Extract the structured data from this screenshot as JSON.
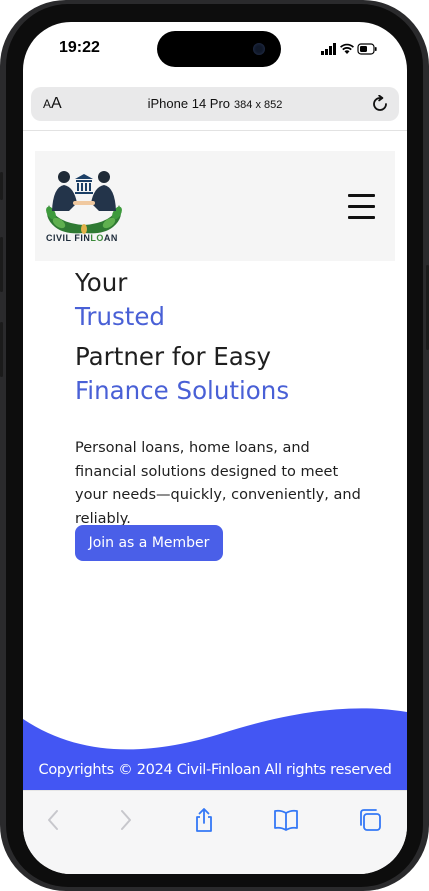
{
  "status_bar": {
    "time": "19:22"
  },
  "url_bar": {
    "aa_small": "A",
    "aa_big": "A",
    "device": "iPhone 14 Pro",
    "dimensions": "384 x 852"
  },
  "header": {
    "logo_text_main": "CIVIL FIN",
    "logo_text_accent": "LO",
    "logo_text_end": "AN"
  },
  "hero": {
    "line1": "Your",
    "line2": "Trusted",
    "line3": "Partner for Easy",
    "line4": "Finance Solutions",
    "description": "Personal loans, home loans, and financial solutions designed to meet your needs—quickly, conveniently, and reliably.",
    "cta_label": "Join as a Member"
  },
  "footer": {
    "copyright": "Copyrights © 2024 Civil-Finloan All rights reserved"
  },
  "colors": {
    "accent_blue": "#4a5fe8",
    "heading_blue": "#4960d6",
    "wave_blue": "#4356f3"
  },
  "icons": [
    "reload-icon",
    "hamburger-menu-icon",
    "back-arrow-icon",
    "forward-arrow-icon",
    "share-icon",
    "bookmarks-icon",
    "tabs-icon"
  ]
}
